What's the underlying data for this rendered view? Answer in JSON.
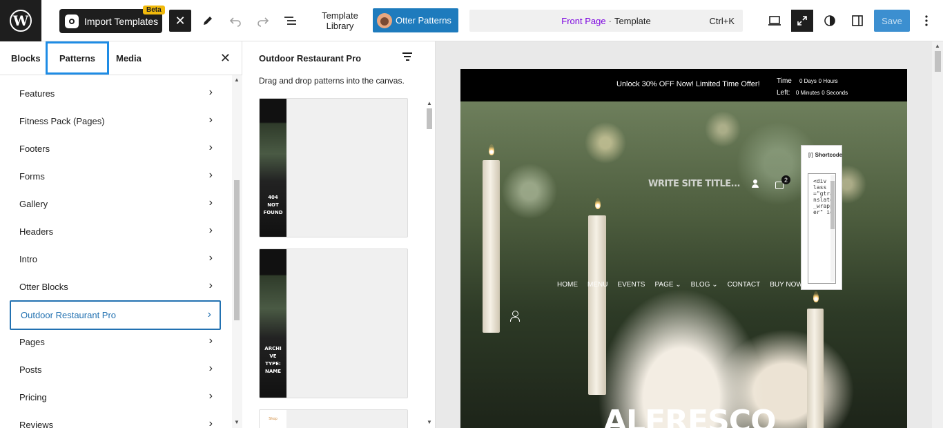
{
  "toolbar": {
    "import_label": "Import Templates",
    "beta_label": "Beta",
    "template_library_label": "Template Library",
    "otter_patterns_label": "Otter Patterns",
    "doc_page": "Front Page",
    "doc_sep": "·",
    "doc_type": "Template",
    "doc_shortcut": "Ctrl+K",
    "save_label": "Save"
  },
  "sidebar": {
    "tabs": [
      {
        "label": "Blocks",
        "active": false
      },
      {
        "label": "Patterns",
        "active": true
      },
      {
        "label": "Media",
        "active": false
      }
    ],
    "categories": [
      {
        "label": "Features",
        "selected": false
      },
      {
        "label": "Fitness Pack (Pages)",
        "selected": false
      },
      {
        "label": "Footers",
        "selected": false
      },
      {
        "label": "Forms",
        "selected": false
      },
      {
        "label": "Gallery",
        "selected": false
      },
      {
        "label": "Headers",
        "selected": false
      },
      {
        "label": "Intro",
        "selected": false
      },
      {
        "label": "Otter Blocks",
        "selected": false
      },
      {
        "label": "Outdoor Restaurant Pro",
        "selected": true
      },
      {
        "label": "Pages",
        "selected": false
      },
      {
        "label": "Posts",
        "selected": false
      },
      {
        "label": "Pricing",
        "selected": false
      },
      {
        "label": "Reviews",
        "selected": false
      }
    ]
  },
  "patterns_panel": {
    "title": "Outdoor Restaurant Pro",
    "description": "Drag and drop patterns into the canvas.",
    "cards": [
      {
        "thumb_text": "404 NOT FOUND"
      },
      {
        "thumb_text": "ARCHI VE TYPE: NAME"
      },
      {
        "thumb_text": "Shop"
      }
    ]
  },
  "site": {
    "offer_text": "Unlock 30% OFF Now! Limited Time Offer!",
    "timer_label_1": "Time",
    "timer_label_2": "Left:",
    "days": "0 Days",
    "hours": "0 Hours",
    "minutes": "0 Minutes",
    "seconds": "0 Seconds",
    "site_title": "WRITE SITE TITLE...",
    "cart_count": "2",
    "nav": [
      "HOME",
      "MENU",
      "EVENTS",
      "PAGE ⌄",
      "BLOG ⌄",
      "CONTACT",
      "BUY NOW"
    ],
    "hero_title": "ALFRESCO",
    "shortcode_bracket": "[/]",
    "shortcode_title": "Shortcode",
    "shortcode_code": "<div class=\"gtranslate_wrapper\" id"
  },
  "icons": [
    "wordpress-icon",
    "import-templates-icon",
    "close-icon",
    "pen-icon",
    "undo-icon",
    "redo-icon",
    "list-view-icon",
    "desktop-icon",
    "fullscreen-icon",
    "contrast-icon",
    "sidebar-icon",
    "more-icon",
    "filter-icon",
    "chevron-right-icon",
    "user-icon",
    "cart-icon"
  ],
  "colors": {
    "accent": "#1e8ce5",
    "selected": "#2271b1",
    "template_link": "#7a00df",
    "save": "#3c8fd0",
    "otter": "#1e7bbd",
    "beta": "#f0b90b"
  }
}
